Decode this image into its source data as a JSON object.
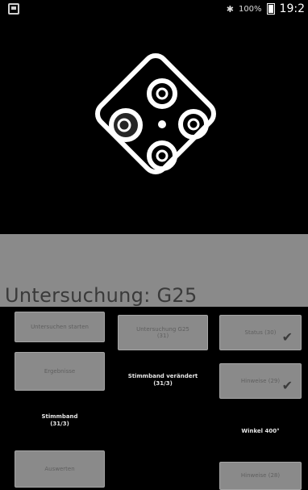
{
  "status_bar": {
    "battery_percent": "100%",
    "time": "19:2",
    "bluetooth_icon": "bluetooth-icon",
    "battery_icon": "battery-icon",
    "app_icon": "gallery-icon"
  },
  "stage": {
    "icon": "diamond-target-icon",
    "colors": {
      "outline": "#ffffff",
      "background": "#000000",
      "band": "#8a8a8a"
    }
  },
  "title": "Untersuchung: G25",
  "buttons": {
    "top_left": "Untersuchen starten",
    "top_middle_line1": "Untersuchung G25",
    "top_middle_line2": "(31)",
    "top_right": "Status (30)",
    "left_second": "Ergebnisse",
    "right_second": "Hinweise (29)",
    "bottom_left": "Auswerten",
    "bottom_right": "Hinweise (28)"
  },
  "info": {
    "middle_title": "Stimmband verändert",
    "middle_sub": "(31/3)",
    "left_title": "Stimmband",
    "left_sub": "(31/3)",
    "right_title": "Winkel 400°"
  }
}
